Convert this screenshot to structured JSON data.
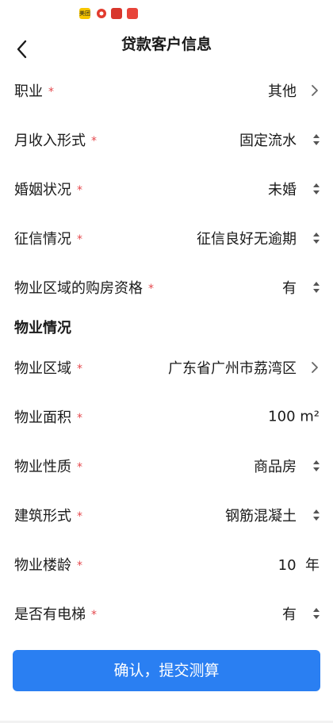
{
  "status_bar": {
    "icons": [
      "meituan-app-icon",
      "app-icon-2",
      "app-icon-3",
      "app-icon-4"
    ],
    "icon_texts": [
      "美团",
      "",
      "",
      ""
    ]
  },
  "header": {
    "title": "贷款客户信息",
    "back_icon": "chevron-left-icon"
  },
  "required_mark": "*",
  "rows_top": [
    {
      "label": "职业",
      "value": "其他",
      "control": "chevron"
    },
    {
      "label": "月收入形式",
      "value": "固定流水",
      "control": "updown"
    },
    {
      "label": "婚姻状况",
      "value": "未婚",
      "control": "updown"
    },
    {
      "label": "征信情况",
      "value": "征信良好无逾期",
      "control": "updown"
    },
    {
      "label": "物业区域的购房资格",
      "value": "有",
      "control": "updown"
    }
  ],
  "section": {
    "title": "物业情况"
  },
  "rows_property": [
    {
      "label": "物业区域",
      "value": "广东省广州市荔湾区",
      "control": "chevron"
    },
    {
      "label": "物业面积",
      "value": "100 m²",
      "control": "none"
    },
    {
      "label": "物业性质",
      "value": "商品房",
      "control": "updown"
    },
    {
      "label": "建筑形式",
      "value": "钢筋混凝土",
      "control": "updown"
    },
    {
      "label": "物业楼龄",
      "value": "10  年",
      "control": "none"
    },
    {
      "label": "是否有电梯",
      "value": "有",
      "control": "updown"
    }
  ],
  "submit": {
    "label": "确认，提交测算"
  },
  "colors": {
    "accent": "#2a7ff2",
    "required": "#e5484d",
    "text": "#1a1a1a",
    "icon": "#666666"
  }
}
